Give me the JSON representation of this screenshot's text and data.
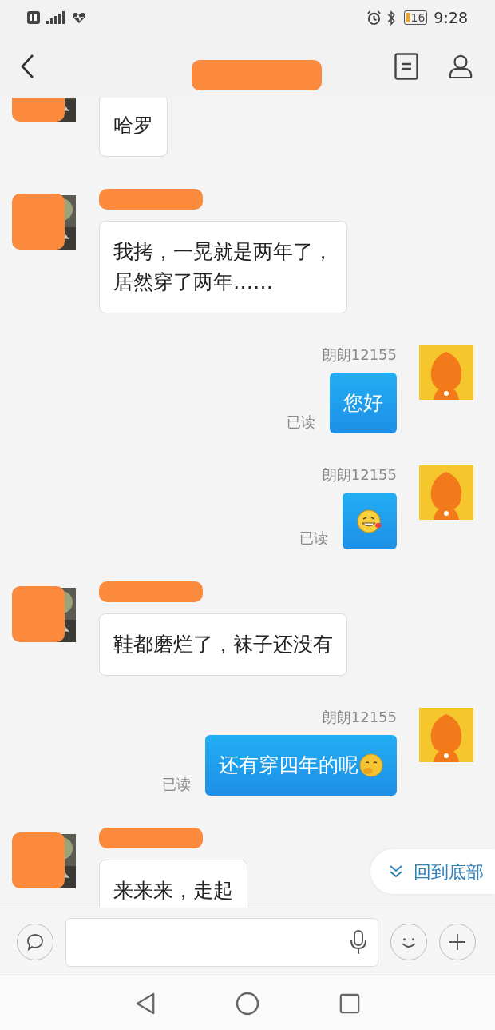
{
  "status_bar": {
    "battery": "16",
    "time": "9:28"
  },
  "messages": [
    {
      "kind": "in",
      "lines": [
        "哈罗"
      ]
    },
    {
      "kind": "in",
      "lines": [
        "我拷，一晃就是两年了，",
        "居然穿了两年……"
      ]
    },
    {
      "kind": "out",
      "sender": "朗朗12155",
      "text": "您好",
      "read": "已读",
      "emoji": false
    },
    {
      "kind": "sticker",
      "sender": "朗朗12155",
      "read": "已读"
    },
    {
      "kind": "in",
      "lines": [
        "鞋都磨烂了，袜子还没有"
      ]
    },
    {
      "kind": "out",
      "sender": "朗朗12155",
      "text": "还有穿四年的呢",
      "read": "已读",
      "emoji": true
    },
    {
      "kind": "in",
      "lines": [
        "来来来，走起"
      ]
    }
  ],
  "jump_button": {
    "label": "回到底部"
  }
}
